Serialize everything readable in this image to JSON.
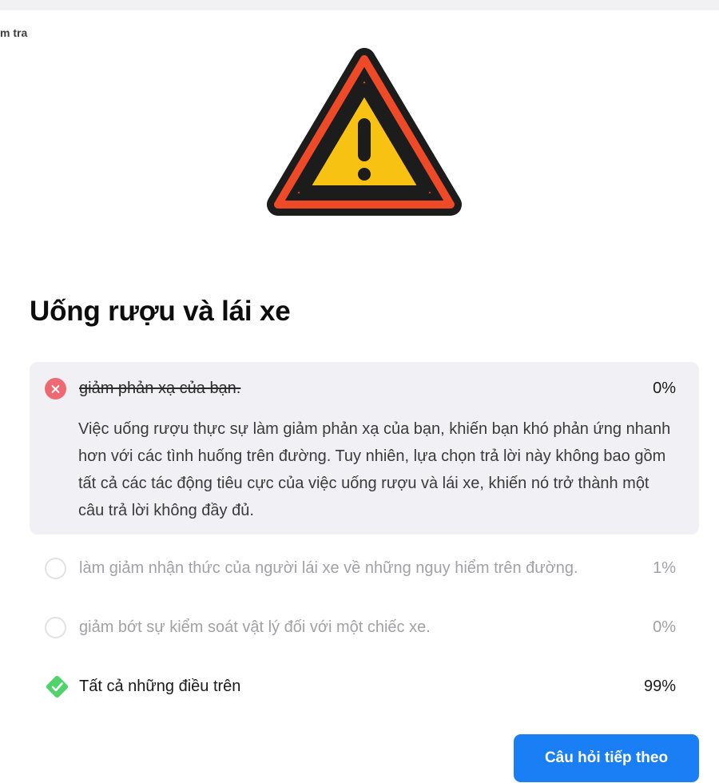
{
  "header": {
    "breadcrumb_fragment": "m tra"
  },
  "illustration": {
    "icon": "warning-triangle-icon",
    "colors": {
      "outline": "#1c1c1c",
      "ring": "#ee4a27",
      "fill": "#f7c211"
    }
  },
  "question": {
    "title": "Uống rượu và lái xe"
  },
  "answers": [
    {
      "label": "giảm phản xạ của bạn.",
      "percent": "0%",
      "state": "selected-wrong",
      "explanation": "Việc uống rượu thực sự làm giảm phản xạ của bạn, khiến bạn khó phản ứng nhanh hơn với các tình huống trên đường. Tuy nhiên, lựa chọn trả lời này không bao gồm tất cả các tác động tiêu cực của việc uống rượu và lái xe, khiến nó trở thành một câu trả lời không đầy đủ."
    },
    {
      "label": "làm giảm nhận thức của người lái xe về những nguy hiểm trên đường.",
      "percent": "1%",
      "state": "unselected"
    },
    {
      "label": "giảm bớt sự kiểm soát vật lý đối với một chiếc xe.",
      "percent": "0%",
      "state": "unselected"
    },
    {
      "label": "Tất cả những điều trên",
      "percent": "99%",
      "state": "correct"
    }
  ],
  "actions": {
    "next_label": "Câu hỏi tiếp theo"
  },
  "colors": {
    "accent": "#1a7ef5",
    "wrong": "#ee6a73",
    "correct": "#4fd36a",
    "selected_bg": "#f1f1f5"
  }
}
